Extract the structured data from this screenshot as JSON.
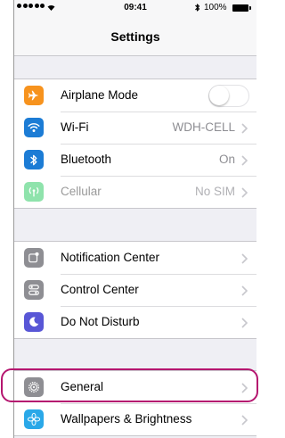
{
  "status_bar": {
    "time": "09:41",
    "battery": "100%"
  },
  "nav": {
    "title": "Settings"
  },
  "group1": [
    {
      "label": "Airplane Mode",
      "control": "toggle",
      "toggle_on": false
    },
    {
      "label": "Wi-Fi",
      "value": "WDH-CELL"
    },
    {
      "label": "Bluetooth",
      "value": "On"
    },
    {
      "label": "Cellular",
      "value": "No SIM",
      "disabled": true
    }
  ],
  "group2": [
    {
      "label": "Notification Center"
    },
    {
      "label": "Control Center"
    },
    {
      "label": "Do Not Disturb"
    }
  ],
  "group3": [
    {
      "label": "General",
      "highlighted": true
    },
    {
      "label": "Wallpapers & Brightness"
    }
  ],
  "icons": {
    "airplane": "airplane-icon",
    "wifi": "wifi-icon",
    "bluetooth": "bluetooth-icon",
    "cellular": "cellular-icon",
    "notification_center": "notification-center-icon",
    "control_center": "control-center-icon",
    "do_not_disturb": "moon-icon",
    "general": "gear-icon",
    "wallpapers": "flower-icon"
  },
  "colors": {
    "airplane": "#f7931e",
    "wifi": "#1c7cd5",
    "bluetooth": "#1c7cd5",
    "cellular": "#8fe3ac",
    "notification_center": "#8e8e93",
    "control_center": "#8e8e93",
    "do_not_disturb": "#5856d6",
    "general": "#8e8e93",
    "wallpapers": "#2aa8e8",
    "highlight": "#b5166f"
  }
}
